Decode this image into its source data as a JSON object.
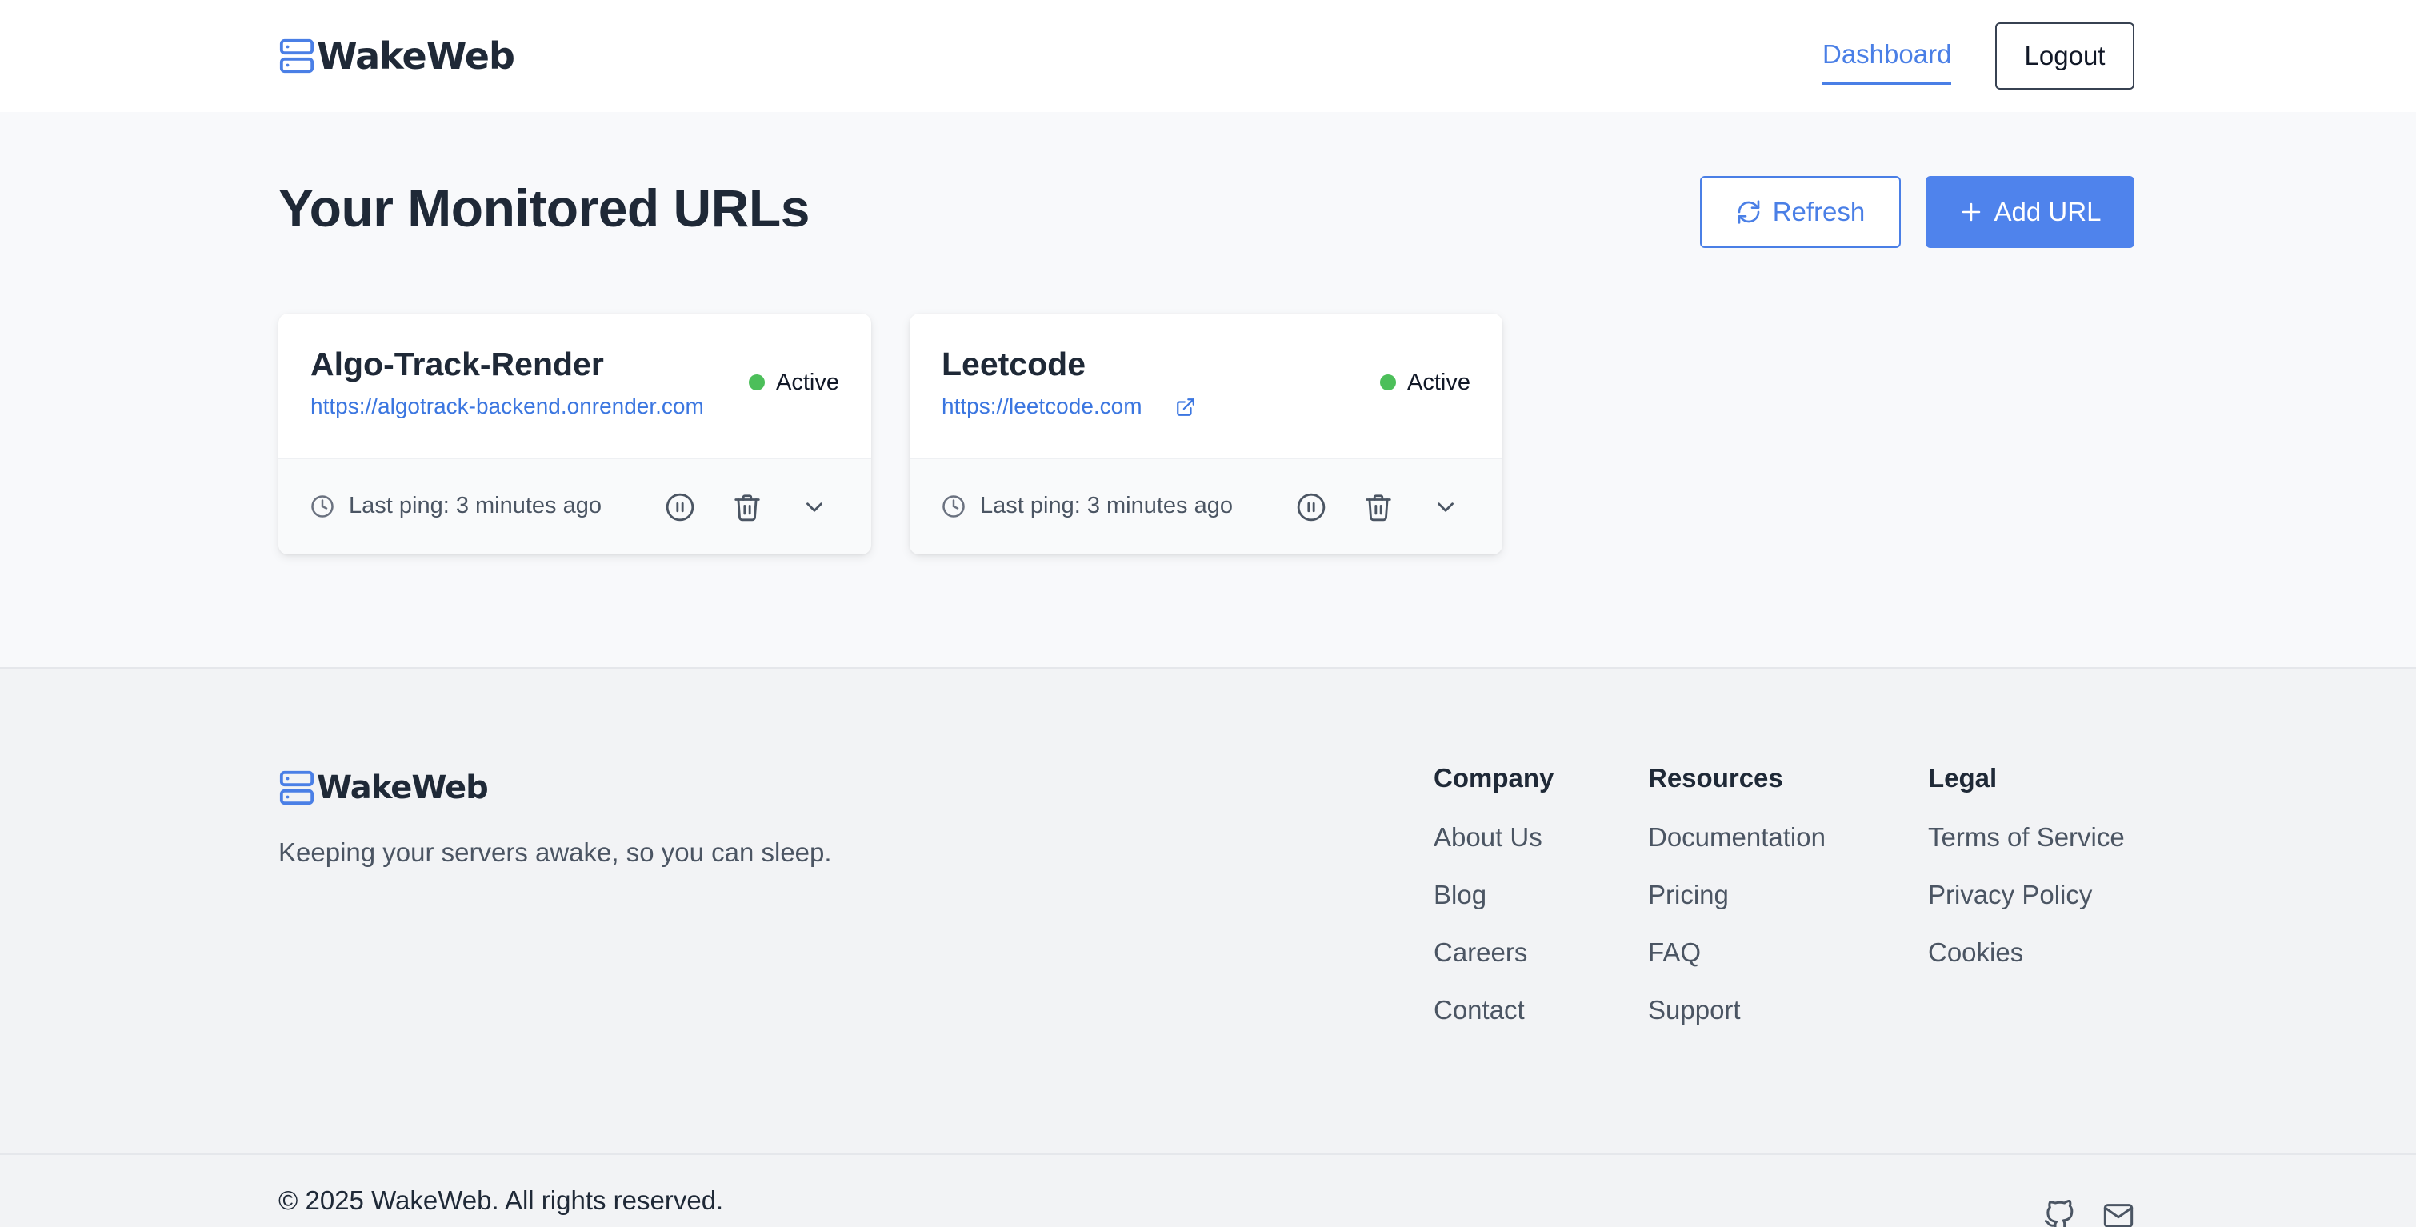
{
  "header": {
    "logo_text": "WakeWeb",
    "nav": {
      "dashboard": "Dashboard",
      "logout": "Logout"
    }
  },
  "main": {
    "title": "Your Monitored URLs",
    "refresh_label": "Refresh",
    "add_label": "Add URL",
    "cards": [
      {
        "name": "Algo-Track-Render",
        "url": "https://algotrack-backend.onrender.com",
        "status": "Active",
        "last_ping": "Last ping: 3 minutes ago"
      },
      {
        "name": "Leetcode",
        "url": "https://leetcode.com",
        "status": "Active",
        "last_ping": "Last ping: 3 minutes ago"
      }
    ]
  },
  "footer": {
    "logo_text": "WakeWeb",
    "tagline": "Keeping your servers awake, so you can sleep.",
    "columns": [
      {
        "title": "Company",
        "links": [
          "About Us",
          "Blog",
          "Careers",
          "Contact"
        ]
      },
      {
        "title": "Resources",
        "links": [
          "Documentation",
          "Pricing",
          "FAQ",
          "Support"
        ]
      },
      {
        "title": "Legal",
        "links": [
          "Terms of Service",
          "Privacy Policy",
          "Cookies"
        ]
      }
    ],
    "copyright": "© 2025 WakeWeb. All rights reserved."
  },
  "icons": {
    "logo": "server-icon",
    "refresh": "refresh-icon",
    "add": "plus-icon",
    "external": "external-link-icon",
    "clock": "clock-icon",
    "pause": "pause-icon",
    "delete": "trash-icon",
    "expand": "chevron-down-icon",
    "github": "github-icon",
    "mail": "mail-icon"
  },
  "colors": {
    "accent": "#4f83ec",
    "link": "#3b76e0",
    "status_active": "#4cbf5a",
    "text": "#1f2937",
    "muted": "#4b5563"
  }
}
